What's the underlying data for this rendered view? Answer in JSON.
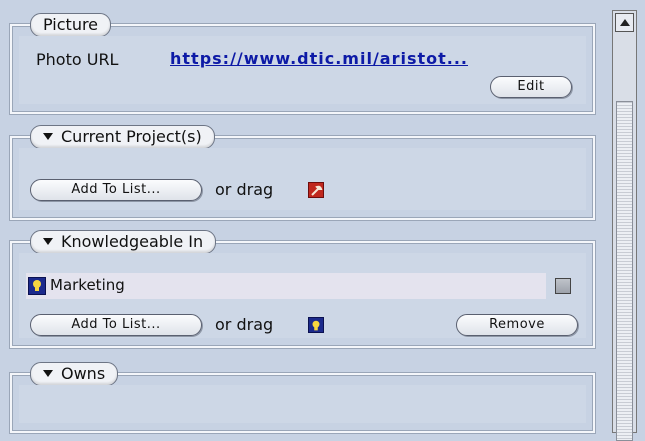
{
  "picture": {
    "legend": "Picture",
    "photo_url_label": "Photo URL",
    "photo_url_value": "https://www.dtic.mil/aristot...",
    "edit_label": "Edit"
  },
  "current_projects": {
    "legend": "Current Project(s)",
    "add_label": "Add To List...",
    "drag_label": "or drag",
    "drag_icon": "wrench-icon"
  },
  "knowledgeable_in": {
    "legend": "Knowledgeable In",
    "items": [
      {
        "icon": "lightbulb-icon",
        "label": "Marketing"
      }
    ],
    "add_label": "Add To List...",
    "drag_label": "or drag",
    "drag_icon": "lightbulb-icon",
    "remove_label": "Remove"
  },
  "owns": {
    "legend": "Owns"
  },
  "colors": {
    "background": "#c7d2e3",
    "link": "#0d1aa6",
    "row_highlight": "#e4e3ee"
  }
}
